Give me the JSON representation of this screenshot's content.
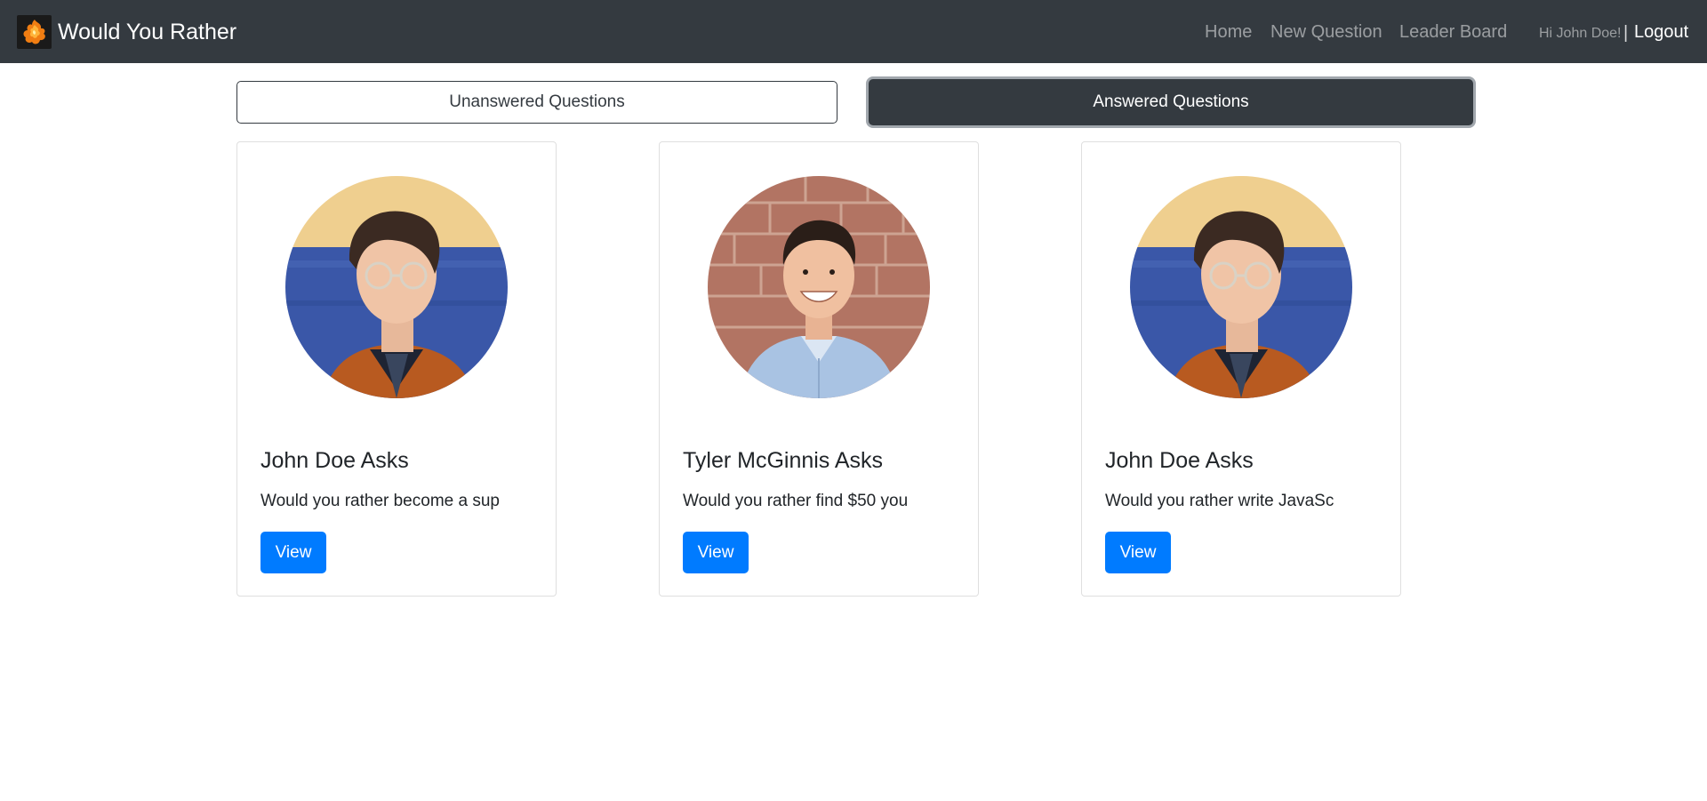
{
  "app": {
    "title": "Would You Rather",
    "logo_icon": "flame-logo-icon"
  },
  "nav": {
    "links": [
      "Home",
      "New Question",
      "Leader Board"
    ],
    "greeting": "Hi John Doe!",
    "separator": "|",
    "logout": "Logout"
  },
  "tabs": {
    "unanswered": "Unanswered Questions",
    "answered": "Answered Questions",
    "active": "answered"
  },
  "cards": [
    {
      "title": "John Doe Asks",
      "text": "Would you rather become a sup",
      "button": "View",
      "avatar": "john-doe-avatar"
    },
    {
      "title": "Tyler McGinnis Asks",
      "text": "Would you rather find $50 you",
      "button": "View",
      "avatar": "tyler-mcginnis-avatar"
    },
    {
      "title": "John Doe Asks",
      "text": "Would you rather write JavaSc",
      "button": "View",
      "avatar": "john-doe-avatar"
    }
  ],
  "colors": {
    "navbar": "#343a40",
    "primary": "#007bff",
    "card_border": "#dfdfdf"
  }
}
